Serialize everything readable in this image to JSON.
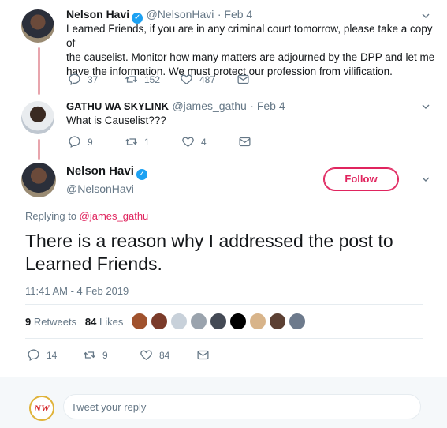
{
  "tweet1": {
    "name": "Nelson Havi",
    "handle": "@NelsonHavi",
    "date": "· Feb 4",
    "text_lines": [
      "Learned Friends, if you are in any criminal court tomorrow, please take a copy of",
      "the causelist. Monitor how many matters are adjourned by the DPP and let me",
      "have the information. We must protect our profession from vilification."
    ],
    "replies": "37",
    "retweets": "152",
    "likes": "487"
  },
  "tweet2": {
    "name": "GATHU WA SKYLINK",
    "handle": "@james_gathu",
    "date": "· Feb 4",
    "text": "What is Causelist???",
    "replies": "9",
    "retweets": "1",
    "likes": "4"
  },
  "main": {
    "name": "Nelson Havi",
    "handle": "@NelsonHavi",
    "follow_label": "Follow",
    "replying_prefix": "Replying to ",
    "replying_handle": "@james_gathu",
    "text_lines": [
      "There is a reason why I addressed the post to",
      "Learned Friends."
    ],
    "timestamp": "11:41 AM - 4 Feb 2019",
    "retweets_count": "9",
    "retweets_label": "Retweets",
    "likes_count": "84",
    "likes_label": "Likes",
    "liker_colors": [
      "#a0522d",
      "#7b3b2a",
      "#c8d1da",
      "#9aa3ad",
      "#444a55",
      "#000000",
      "#d8b48a",
      "#5c4033",
      "#6d7a8c"
    ],
    "replies": "14",
    "retweets": "9",
    "likes": "84"
  },
  "reply": {
    "placeholder": "Tweet your reply",
    "logo_text": "NW"
  },
  "colors": {
    "accent": "#e0245e",
    "muted": "#657786",
    "thread_line": "#e8a5ad"
  }
}
